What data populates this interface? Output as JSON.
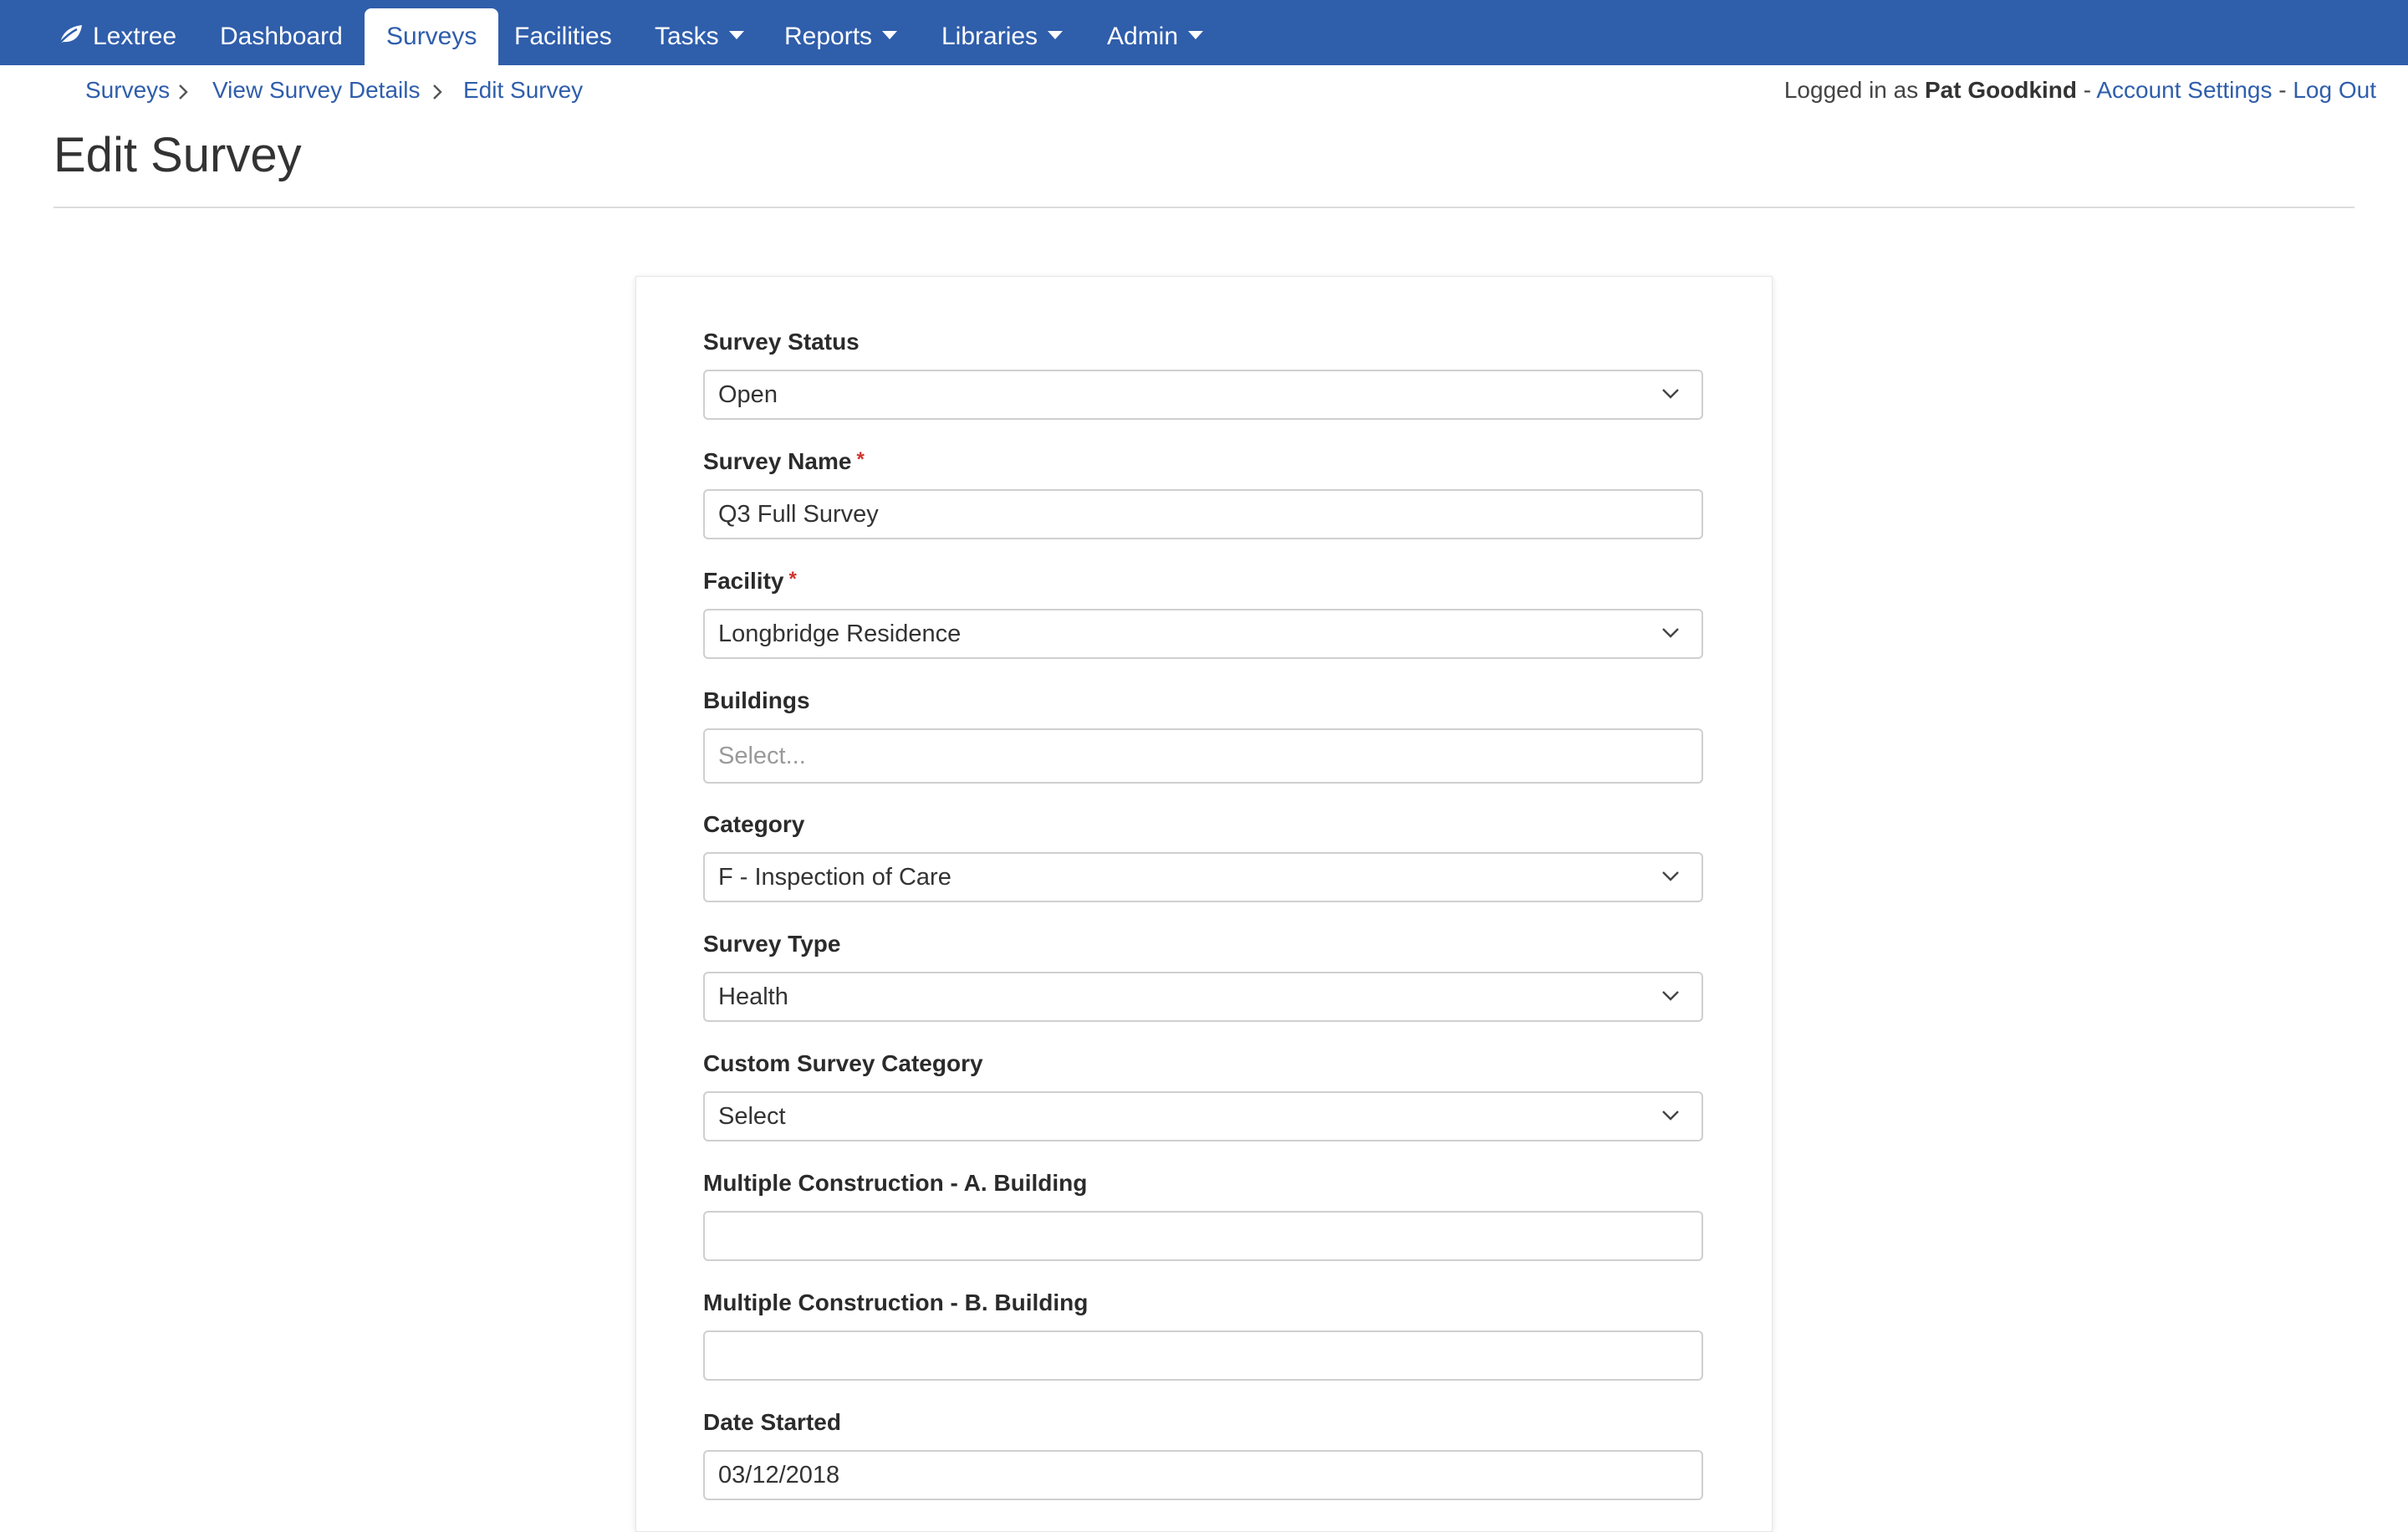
{
  "navbar": {
    "brand": "Lextree",
    "items": [
      {
        "label": "Dashboard"
      },
      {
        "label": "Surveys",
        "active": true
      },
      {
        "label": "Facilities"
      },
      {
        "label": "Tasks",
        "dropdown": true
      },
      {
        "label": "Reports",
        "dropdown": true
      },
      {
        "label": "Libraries",
        "dropdown": true
      },
      {
        "label": "Admin",
        "dropdown": true
      }
    ],
    "colors": {
      "bar": "#2f5eab",
      "text": "#ffffff"
    }
  },
  "breadcrumb": [
    "Surveys",
    "View Survey Details",
    "Edit Survey"
  ],
  "user": {
    "prefix": "Logged in as",
    "name": "Pat Goodkind",
    "separator": "-",
    "account_settings": "Account Settings",
    "logout": "Log Out"
  },
  "page_title": "Edit Survey",
  "form": {
    "required_marker": "*",
    "survey_status": {
      "label": "Survey Status",
      "value": "Open"
    },
    "survey_name": {
      "label": "Survey Name",
      "value": "Q3 Full Survey",
      "required": true
    },
    "facility": {
      "label": "Facility",
      "value": "Longbridge Residence",
      "required": true
    },
    "buildings": {
      "label": "Buildings",
      "placeholder": "Select..."
    },
    "category": {
      "label": "Category",
      "value": "F - Inspection of Care"
    },
    "survey_type": {
      "label": "Survey Type",
      "value": "Health"
    },
    "custom_category": {
      "label": "Custom Survey Category",
      "value": "Select"
    },
    "mc_a": {
      "label": "Multiple Construction - A. Building",
      "value": ""
    },
    "mc_b": {
      "label": "Multiple Construction - B. Building",
      "value": ""
    },
    "date_started": {
      "label": "Date Started",
      "value": "03/12/2018"
    }
  }
}
